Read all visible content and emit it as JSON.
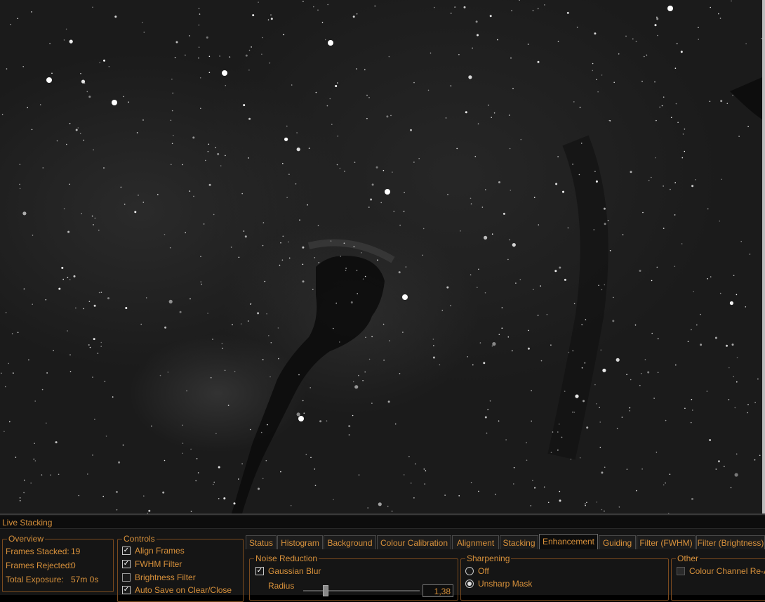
{
  "panel": {
    "title": "Live Stacking"
  },
  "overview": {
    "title": "Overview",
    "frames_stacked_label": "Frames Stacked:",
    "frames_stacked_value": "19",
    "frames_rejected_label": "Frames Rejected:",
    "frames_rejected_value": "0",
    "total_exposure_label": "Total Exposure:",
    "total_exposure_value": "57m 0s"
  },
  "controls": {
    "title": "Controls",
    "items": [
      {
        "label": "Align Frames",
        "checked": true
      },
      {
        "label": "FWHM Filter",
        "checked": true
      },
      {
        "label": "Brightness Filter",
        "checked": false
      },
      {
        "label": "Auto Save on Clear/Close",
        "checked": true
      }
    ]
  },
  "tabs": [
    "Status",
    "Histogram",
    "Background",
    "Colour Calibration",
    "Alignment",
    "Stacking",
    "Enhancement",
    "Guiding",
    "Filter (FWHM)",
    "Filter (Brightness)"
  ],
  "active_tab": "Enhancement",
  "noise_reduction": {
    "title": "Noise Reduction",
    "gaussian_blur_label": "Gaussian Blur",
    "gaussian_blur_checked": true,
    "radius_label": "Radius",
    "radius_value": "1,38"
  },
  "sharpening": {
    "title": "Sharpening",
    "off_label": "Off",
    "unsharp_mask_label": "Unsharp Mask",
    "selected": "Unsharp Mask"
  },
  "other": {
    "title": "Other",
    "colour_channel_label": "Colour Channel Re-A"
  },
  "colors": {
    "accent": "#d8913b",
    "background": "#151515"
  }
}
